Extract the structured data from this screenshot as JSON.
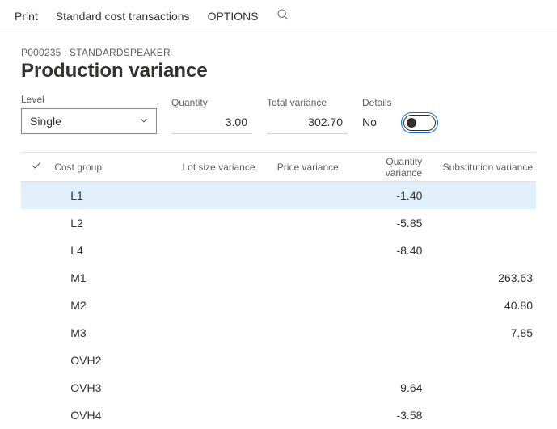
{
  "toolbar": {
    "print": "Print",
    "std_cost": "Standard cost transactions",
    "options": "OPTIONS"
  },
  "header": {
    "record_id": "P000235 : STANDARDSPEAKER",
    "title": "Production variance"
  },
  "fields": {
    "level_label": "Level",
    "level_value": "Single",
    "quantity_label": "Quantity",
    "quantity_value": "3.00",
    "total_variance_label": "Total variance",
    "total_variance_value": "302.70",
    "details_label": "Details",
    "details_value": "No"
  },
  "table": {
    "columns": {
      "cost_group": "Cost group",
      "lot_size": "Lot size variance",
      "price": "Price variance",
      "quantity": "Quantity variance",
      "substitution": "Substitution variance"
    },
    "rows": [
      {
        "cost_group": "L1",
        "lot_size": "",
        "price": "",
        "quantity": "-1.40",
        "substitution": ""
      },
      {
        "cost_group": "L2",
        "lot_size": "",
        "price": "",
        "quantity": "-5.85",
        "substitution": ""
      },
      {
        "cost_group": "L4",
        "lot_size": "",
        "price": "",
        "quantity": "-8.40",
        "substitution": ""
      },
      {
        "cost_group": "M1",
        "lot_size": "",
        "price": "",
        "quantity": "",
        "substitution": "263.63"
      },
      {
        "cost_group": "M2",
        "lot_size": "",
        "price": "",
        "quantity": "",
        "substitution": "40.80"
      },
      {
        "cost_group": "M3",
        "lot_size": "",
        "price": "",
        "quantity": "",
        "substitution": "7.85"
      },
      {
        "cost_group": "OVH2",
        "lot_size": "",
        "price": "",
        "quantity": "",
        "substitution": ""
      },
      {
        "cost_group": "OVH3",
        "lot_size": "",
        "price": "",
        "quantity": "9.64",
        "substitution": ""
      },
      {
        "cost_group": "OVH4",
        "lot_size": "",
        "price": "",
        "quantity": "-3.58",
        "substitution": ""
      }
    ]
  }
}
